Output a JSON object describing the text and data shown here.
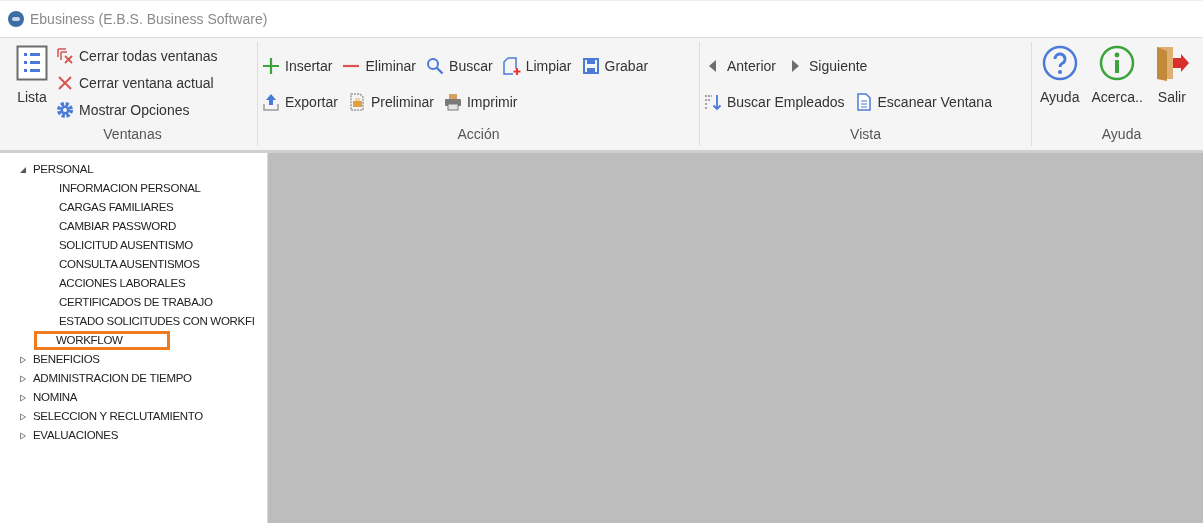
{
  "window": {
    "title": "Ebusiness (E.B.S. Business Software)"
  },
  "ribbon": {
    "groups": [
      {
        "label": "Ventanas",
        "large": [
          {
            "label": "Lista"
          }
        ],
        "rows": [
          [
            {
              "label": "Cerrar todas ventanas"
            }
          ],
          [
            {
              "label": "Cerrar ventana actual"
            }
          ],
          [
            {
              "label": "Mostrar Opciones"
            }
          ]
        ]
      },
      {
        "label": "Acción",
        "rows": [
          [
            {
              "label": "Insertar"
            },
            {
              "label": "Eliminar"
            },
            {
              "label": "Buscar"
            },
            {
              "label": "Limpiar"
            },
            {
              "label": "Grabar"
            }
          ],
          [
            {
              "label": "Exportar"
            },
            {
              "label": "Preliminar"
            },
            {
              "label": "Imprimir"
            }
          ]
        ]
      },
      {
        "label": "Vista",
        "rows": [
          [
            {
              "label": "Anterior"
            },
            {
              "label": "Siguiente"
            }
          ],
          [
            {
              "label": "Buscar Empleados"
            },
            {
              "label": "Escanear Ventana"
            }
          ]
        ]
      },
      {
        "label": "Ayuda",
        "large": [
          {
            "label": "Ayuda"
          },
          {
            "label": "Acerca.."
          },
          {
            "label": "Salir"
          }
        ]
      }
    ]
  },
  "tree": [
    {
      "label": "PERSONAL",
      "expanded": true,
      "children": [
        {
          "label": "INFORMACION PERSONAL",
          "highlighted": false
        },
        {
          "label": "CARGAS FAMILIARES",
          "highlighted": false
        },
        {
          "label": "CAMBIAR PASSWORD",
          "highlighted": false
        },
        {
          "label": "SOLICITUD AUSENTISMO",
          "highlighted": false
        },
        {
          "label": "CONSULTA AUSENTISMOS",
          "highlighted": false
        },
        {
          "label": "ACCIONES LABORALES",
          "highlighted": false
        },
        {
          "label": "CERTIFICADOS DE TRABAJO",
          "highlighted": false
        },
        {
          "label": "ESTADO SOLICITUDES CON WORKFI",
          "highlighted": false
        },
        {
          "label": "WORKFLOW",
          "highlighted": true
        }
      ]
    },
    {
      "label": "BENEFICIOS",
      "expanded": false
    },
    {
      "label": "ADMINISTRACION DE TIEMPO",
      "expanded": false
    },
    {
      "label": "NOMINA",
      "expanded": false
    },
    {
      "label": "SELECCION Y RECLUTAMIENTO",
      "expanded": false
    },
    {
      "label": "EVALUACIONES",
      "expanded": false
    }
  ]
}
